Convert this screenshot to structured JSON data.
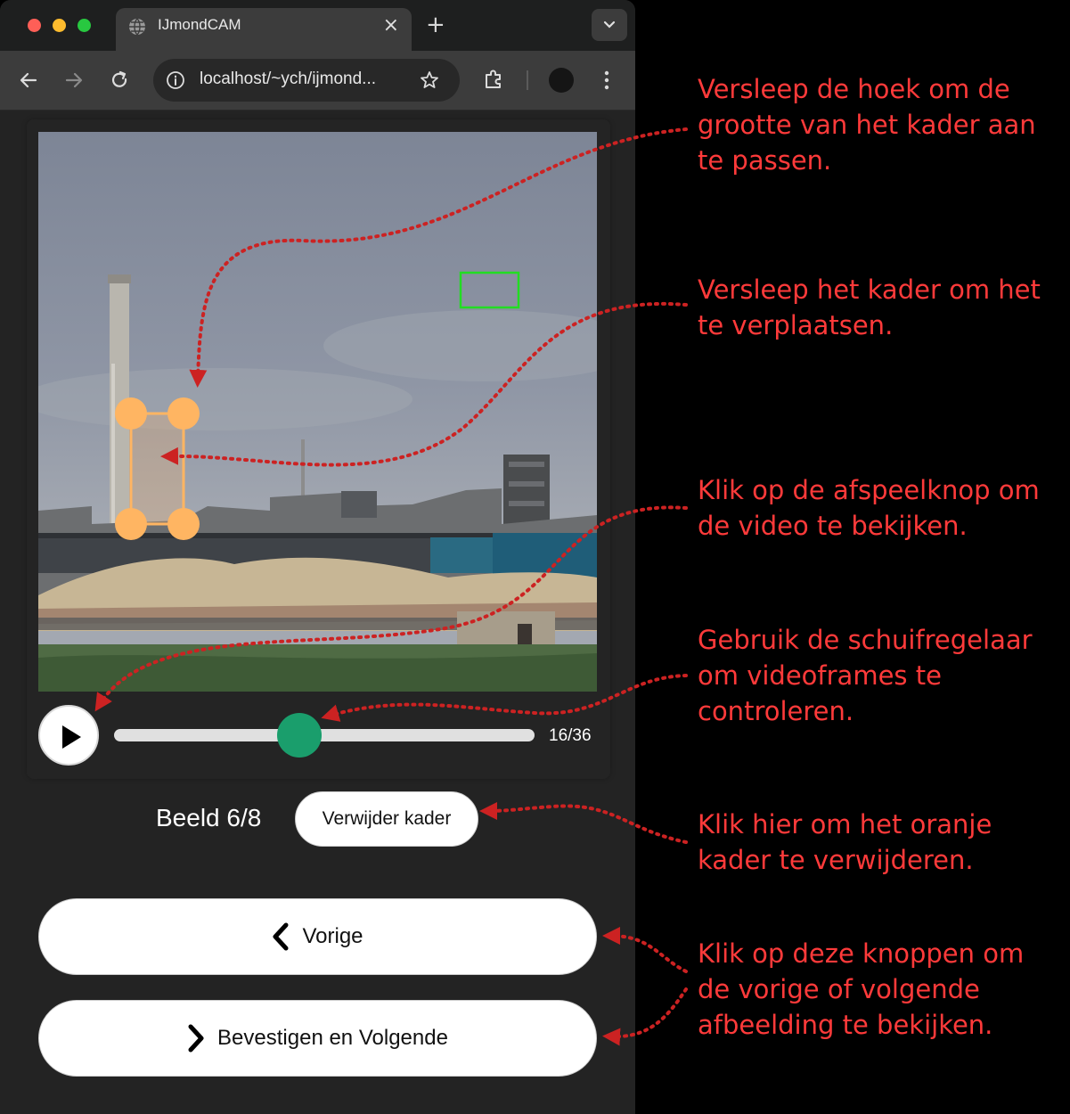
{
  "browser": {
    "tab_title": "IJmondCAM",
    "tab_close": "×",
    "new_tab": "+",
    "url": "localhost/~ych/ijmond..."
  },
  "player": {
    "frame_counter": "16/36",
    "slider_progress": 0.44
  },
  "labeling": {
    "image_label": "Beeld 6/8",
    "remove_box_label": "Verwijder kader"
  },
  "navigation": {
    "prev_label": "Vorige",
    "next_label": "Bevestigen en Volgende"
  },
  "annotations": [
    {
      "text": "Versleep de hoek om de grootte van het kader aan te passen."
    },
    {
      "text": "Versleep het kader om het te verplaatsen."
    },
    {
      "text": "Klik op de afspeelknop om de video te bekijken."
    },
    {
      "text": "Gebruik de schuifregelaar om videoframes te controleren."
    },
    {
      "text": "Klik hier om het oranje kader te verwijderen."
    },
    {
      "text": "Klik op deze knoppen om de vorige of volgende afbeelding te bekijken."
    }
  ],
  "colors": {
    "annotation": "#ff3a3a",
    "slider_thumb": "#1a9e6c",
    "orange_box": "#ffb562",
    "green_box": "#22dd22"
  }
}
